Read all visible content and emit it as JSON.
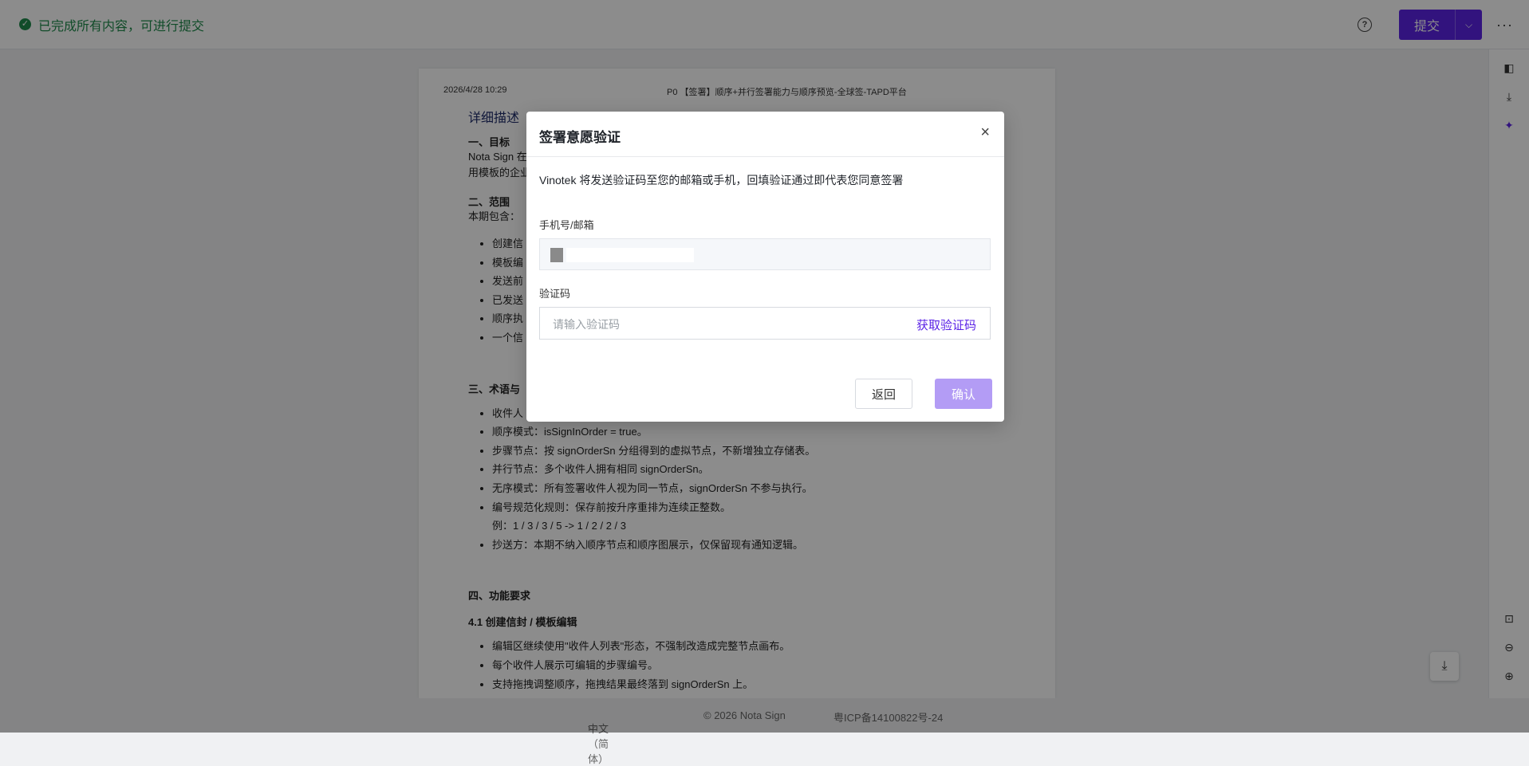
{
  "topbar": {
    "status_icon": "check-circle-icon",
    "status_text": "已完成所有内容，可进行提交",
    "help_icon": "?",
    "submit_label": "提交",
    "dropdown_icon": "⌵",
    "more_icon": "···",
    "accent_color": "#5b23e6",
    "status_color": "#1f8a4c"
  },
  "document": {
    "date": "2026/4/28 10:29",
    "header_title": "P0 【签署】顺序+并行签署能力与顺序预览-全球签-TAPD平台",
    "section_title": "详细描述",
    "goal_heading": "一、目标",
    "goal_line1": "Nota Sign 在",
    "goal_line2": "用模板的企业",
    "scope_heading": "二、范围",
    "scope_intro": "本期包含：",
    "scope_items": [
      "创建信",
      "模板编",
      "发送前",
      "已发送",
      "顺序执",
      "一个信"
    ],
    "terms_heading": "三、术语与",
    "terms_items": [
      "收件人",
      "顺序模式：isSignInOrder = true。",
      "步骤节点：按 signOrderSn 分组得到的虚拟节点，不新增独立存储表。",
      "并行节点：多个收件人拥有相同 signOrderSn。",
      "无序模式：所有签署收件人视为同一节点，signOrderSn 不参与执行。",
      "编号规范化规则：保存前按升序重排为连续正整数。"
    ],
    "terms_example": "例：1 / 3 / 3 / 5 -> 1 / 2 / 2 / 3",
    "terms_cc": "抄送方：本期不纳入顺序节点和顺序图展示，仅保留现有通知逻辑。",
    "func_heading": "四、功能要求",
    "func_sub": "4.1 创建信封 / 模板编辑",
    "func_items": [
      "编辑区继续使用\"收件人列表\"形态，不强制改造成完整节点画布。",
      "每个收件人展示可编辑的步骤编号。",
      "支持拖拽调整顺序，拖拽结果最终落到 signOrderSn 上。"
    ]
  },
  "rightbar": {
    "icons": [
      "panel-icon",
      "download-icon",
      "ai-sparkle-icon",
      "fit-width-icon",
      "zoom-out-icon",
      "zoom-in-icon"
    ]
  },
  "footer": {
    "language": "中文（简体）",
    "language_chevron": "⌵",
    "copyright": "© 2026 Nota Sign",
    "icp": "粤ICP备14100822号-24"
  },
  "modal": {
    "title": "签署意愿验证",
    "close_icon": "×",
    "description": "Vinotek 将发送验证码至您的邮箱或手机，回填验证通过即代表您同意签署",
    "phone_label": "手机号/邮箱",
    "code_label": "验证码",
    "code_placeholder": "请输入验证码",
    "get_code_label": "获取验证码",
    "back_label": "返回",
    "confirm_label": "确认"
  }
}
